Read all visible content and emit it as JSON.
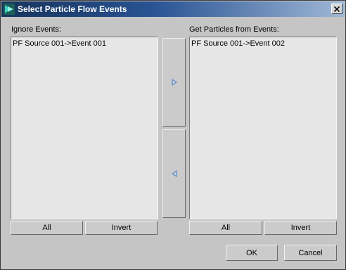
{
  "window": {
    "title": "Select Particle Flow Events"
  },
  "ignore": {
    "label": "Ignore Events:",
    "items": [
      "PF Source 001->Event 001"
    ],
    "all_label": "All",
    "invert_label": "Invert"
  },
  "get": {
    "label": "Get Particles from Events:",
    "items": [
      "PF Source 001->Event 002"
    ],
    "all_label": "All",
    "invert_label": "Invert"
  },
  "footer": {
    "ok_label": "OK",
    "cancel_label": "Cancel"
  },
  "icons": {
    "move_right": "triangle-right-icon",
    "move_left": "triangle-left-icon",
    "close": "close-icon",
    "app": "particle-flow-icon"
  },
  "colors": {
    "arrow": "#5b8fd0",
    "title_bar": "#16335c"
  }
}
